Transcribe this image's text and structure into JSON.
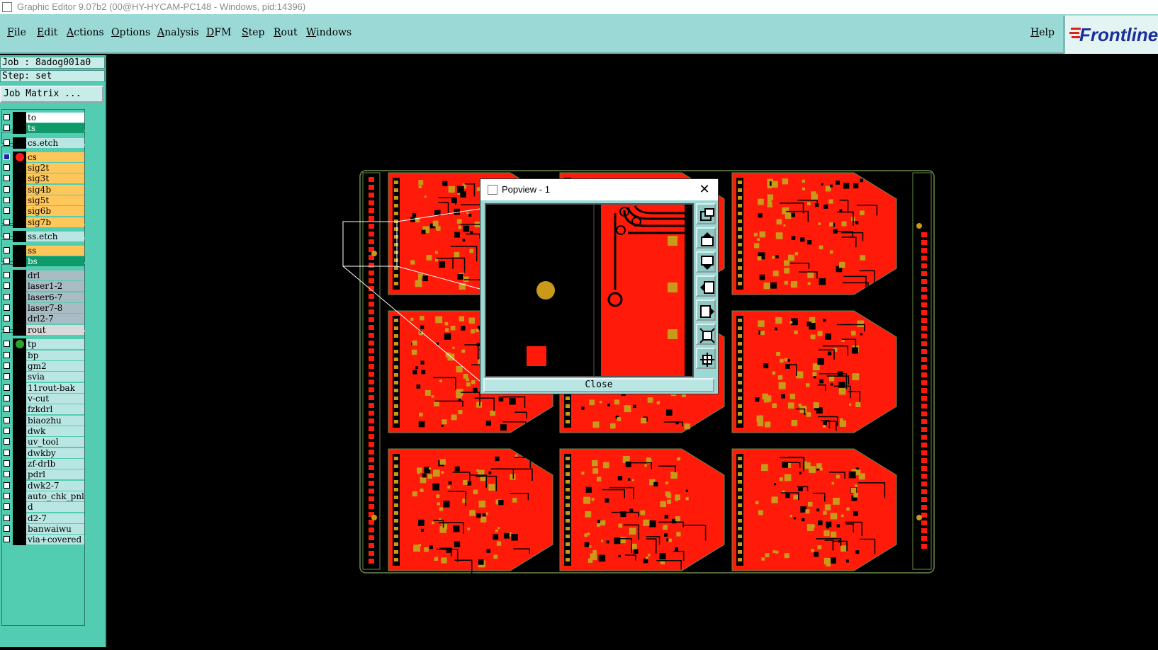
{
  "window": {
    "title": "Graphic Editor 9.07b2 (00@HY-HYCAM-PC148 - Windows, pid:14396)"
  },
  "menu": {
    "items": [
      {
        "label": "File"
      },
      {
        "label": "Edit"
      },
      {
        "label": "Actions"
      },
      {
        "label": "Options"
      },
      {
        "label": "Analysis"
      },
      {
        "label": "DFM"
      },
      {
        "label": "Step"
      },
      {
        "label": "Rout"
      },
      {
        "label": "Windows"
      }
    ],
    "help": "Help"
  },
  "brand": {
    "name": "Frontline"
  },
  "job": {
    "job_line": "Job : 8adog001a0",
    "step_line": "Step: set",
    "matrix_button": "Job Matrix ..."
  },
  "layers": [
    {
      "name": "to",
      "bg": "#ffffff"
    },
    {
      "name": "ts",
      "bg": "#0f9a6a"
    },
    {
      "name": "cs.etch",
      "bg": "#b9e6e2"
    },
    {
      "name": "cs",
      "bg": "#ffc65a",
      "active": true,
      "dot": "#ff1a1a"
    },
    {
      "name": "sig2t",
      "bg": "#ffc65a"
    },
    {
      "name": "sig3t",
      "bg": "#ffc65a"
    },
    {
      "name": "sig4b",
      "bg": "#ffc65a"
    },
    {
      "name": "sig5t",
      "bg": "#ffc65a"
    },
    {
      "name": "sig6b",
      "bg": "#ffc65a"
    },
    {
      "name": "sig7b",
      "bg": "#ffc65a"
    },
    {
      "name": "ss.etch",
      "bg": "#b9e6e2"
    },
    {
      "name": "ss",
      "bg": "#ffc65a"
    },
    {
      "name": "bs",
      "bg": "#0f9a6a"
    },
    {
      "name": "drl",
      "bg": "#a9bcc4"
    },
    {
      "name": "laser1-2",
      "bg": "#a9bcc4"
    },
    {
      "name": "laser6-7",
      "bg": "#a9bcc4"
    },
    {
      "name": "laser7-8",
      "bg": "#a9bcc4"
    },
    {
      "name": "drl2-7",
      "bg": "#a9bcc4"
    },
    {
      "name": "rout",
      "bg": "#d9d9d9"
    },
    {
      "name": "tp",
      "bg": "#b9e6e2",
      "dot": "#2ea12e"
    },
    {
      "name": "bp",
      "bg": "#b9e6e2"
    },
    {
      "name": "gm2",
      "bg": "#b9e6e2"
    },
    {
      "name": "svia",
      "bg": "#b9e6e2"
    },
    {
      "name": "11rout-bak",
      "bg": "#b9e6e2"
    },
    {
      "name": "v-cut",
      "bg": "#b9e6e2"
    },
    {
      "name": "fzkdrl",
      "bg": "#b9e6e2"
    },
    {
      "name": "biaozhu",
      "bg": "#b9e6e2"
    },
    {
      "name": "dwk",
      "bg": "#b9e6e2"
    },
    {
      "name": "uv_tool",
      "bg": "#b9e6e2"
    },
    {
      "name": "dwkby",
      "bg": "#b9e6e2"
    },
    {
      "name": "zf-drlb",
      "bg": "#b9e6e2"
    },
    {
      "name": "pdrl",
      "bg": "#b9e6e2"
    },
    {
      "name": "dwk2-7",
      "bg": "#b9e6e2"
    },
    {
      "name": "auto_chk_pnl",
      "bg": "#b9e6e2"
    },
    {
      "name": "d",
      "bg": "#b9e6e2"
    },
    {
      "name": "d2-7",
      "bg": "#b9e6e2"
    },
    {
      "name": "banwaiwu",
      "bg": "#b9e6e2"
    },
    {
      "name": "via+covered",
      "bg": "#b9e6e2"
    }
  ],
  "popview": {
    "title": "Popview - 1",
    "close_label": "Close",
    "buttons": [
      "zoom-home-icon",
      "pan-up-icon",
      "pan-down-icon",
      "pan-left-icon",
      "pan-right-icon",
      "zoom-out-icon",
      "zoom-in-icon"
    ]
  },
  "colors": {
    "copper": "#ff1a0a",
    "pad": "#c99a1a",
    "panel_bg": "#52cdb2",
    "menubar": "#9ad9d5"
  }
}
